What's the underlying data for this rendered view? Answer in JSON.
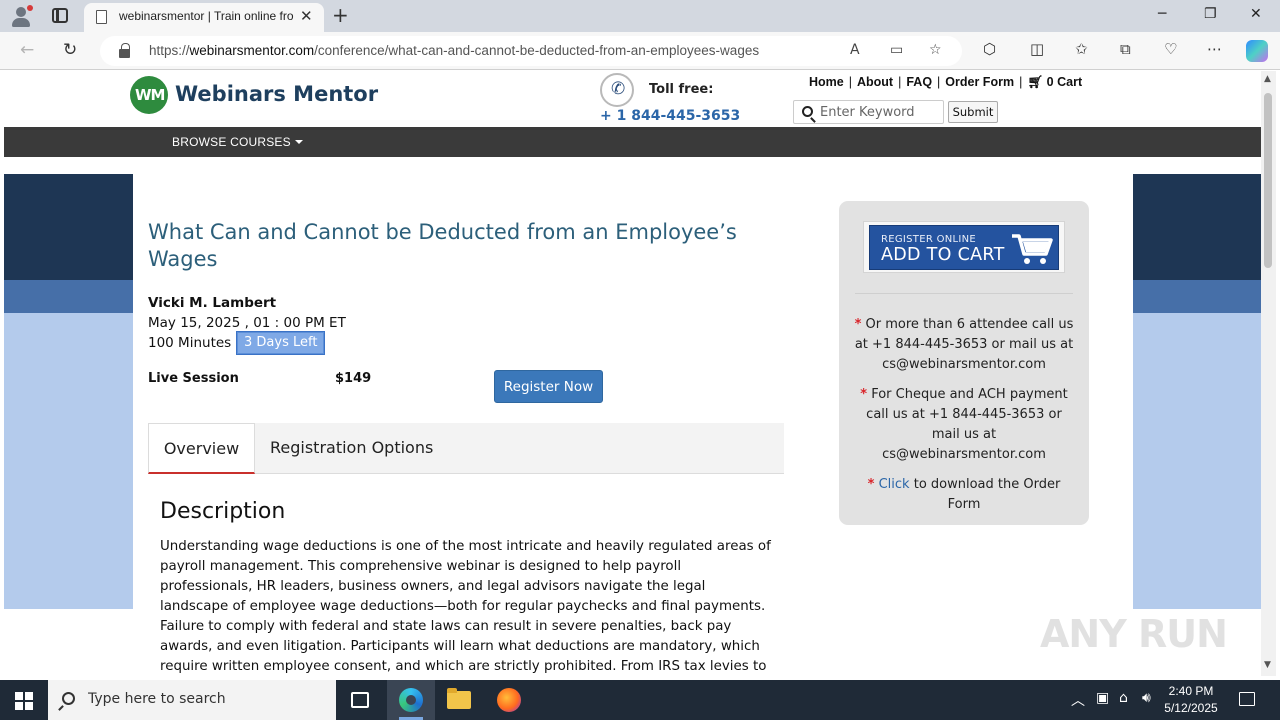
{
  "browser": {
    "tab_title": "webinarsmentor | Train online fro",
    "tab_close": "✕",
    "new_tab": "+",
    "url_prefix": "https://",
    "url_domain": "webinarsmentor.com",
    "url_path": "/conference/what-can-and-cannot-be-deducted-from-an-employees-wages",
    "window_controls": {
      "minimize": "─",
      "maximize": "❐",
      "close": "✕"
    }
  },
  "site": {
    "logo_mark": "WM",
    "logo_text": "Webinars Mentor",
    "toll_free_label": "Toll free:",
    "toll_free_number": "+ 1 844-445-3653",
    "nav": {
      "home": "Home",
      "about": "About",
      "faq": "FAQ",
      "order_form": "Order Form",
      "cart": "0 Cart"
    },
    "search_placeholder": "Enter Keyword",
    "submit_label": "Submit",
    "browse_courses": "BROWSE COURSES"
  },
  "course": {
    "title": "What Can and Cannot be Deducted from an Employee’s Wages",
    "presenter": "Vicki M. Lambert",
    "date": "May 15, 2025 , 01 : 00 PM ET",
    "duration": "100 Minutes |",
    "days_left": "3 Days Left",
    "session_label": "Live Session",
    "price": "$149",
    "register_label": "Register Now",
    "tabs": [
      "Overview",
      "Registration Options"
    ],
    "description_heading": "Description",
    "description_text": "Understanding wage deductions is one of the most intricate and heavily regulated areas of payroll management. This comprehensive webinar is designed to help payroll professionals, HR leaders, business owners, and legal advisors navigate the legal landscape of employee wage deductions—both for regular paychecks and final payments. Failure to comply with federal and state laws can result in severe penalties, back pay awards, and even litigation. Participants will learn what deductions are mandatory, which require written employee consent, and which are strictly prohibited. From IRS tax levies to state garnishment limits, this session covers it all."
  },
  "sidebar": {
    "cart_small": "REGISTER ONLINE",
    "cart_big": "ADD TO CART",
    "star": "*",
    "note1": "Or more than 6 attendee call us at +1 844-445-3653 or mail us at cs@webinarsmentor.com",
    "note2": "For Cheque and ACH payment call us at +1 844-445-3653 or mail us at cs@webinarsmentor.com",
    "note3_link": "Click",
    "note3_text": "to download the Order Form"
  },
  "watermark": "ANY RUN",
  "taskbar": {
    "search_placeholder": "Type here to search",
    "time": "2:40 PM",
    "date": "5/12/2025"
  }
}
